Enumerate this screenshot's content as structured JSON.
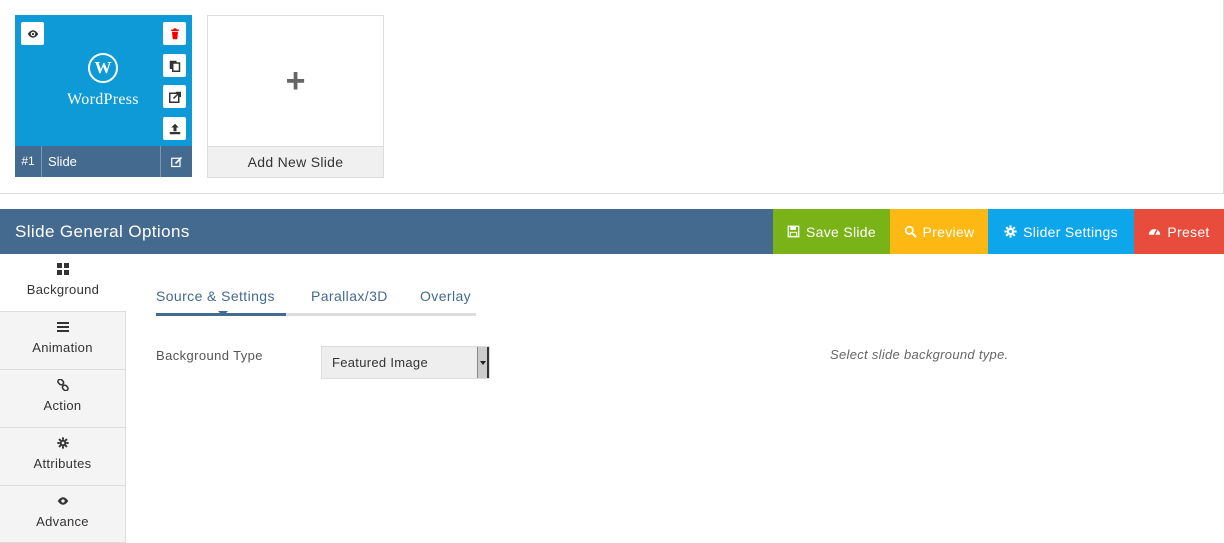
{
  "slides": [
    {
      "number": "#1",
      "name": "Slide",
      "thumb_logo_letter": "W",
      "thumb_logo_text": "WordPress"
    }
  ],
  "add_slide": {
    "icon": "+",
    "label": "Add New Slide"
  },
  "options": {
    "title": "Slide General Options",
    "buttons": {
      "save": "Save Slide",
      "preview": "Preview",
      "settings": "Slider Settings",
      "preset": "Preset"
    }
  },
  "side_tabs": [
    {
      "label": "Background",
      "icon": "grid-icon"
    },
    {
      "label": "Animation",
      "icon": "list-icon"
    },
    {
      "label": "Action",
      "icon": "link-icon"
    },
    {
      "label": "Attributes",
      "icon": "gear-icon"
    },
    {
      "label": "Advance",
      "icon": "eye-icon"
    }
  ],
  "sub_tabs": [
    "Source & Settings",
    "Parallax/3D",
    "Overlay"
  ],
  "background": {
    "label": "Background Type",
    "value": "Featured Image",
    "help": "Select slide background type."
  },
  "colors": {
    "header": "#456a8f",
    "save": "#7ab317",
    "preview": "#fdb813",
    "settings": "#0ea6ea",
    "preset": "#e84c3d",
    "thumb": "#0e9ad6"
  }
}
